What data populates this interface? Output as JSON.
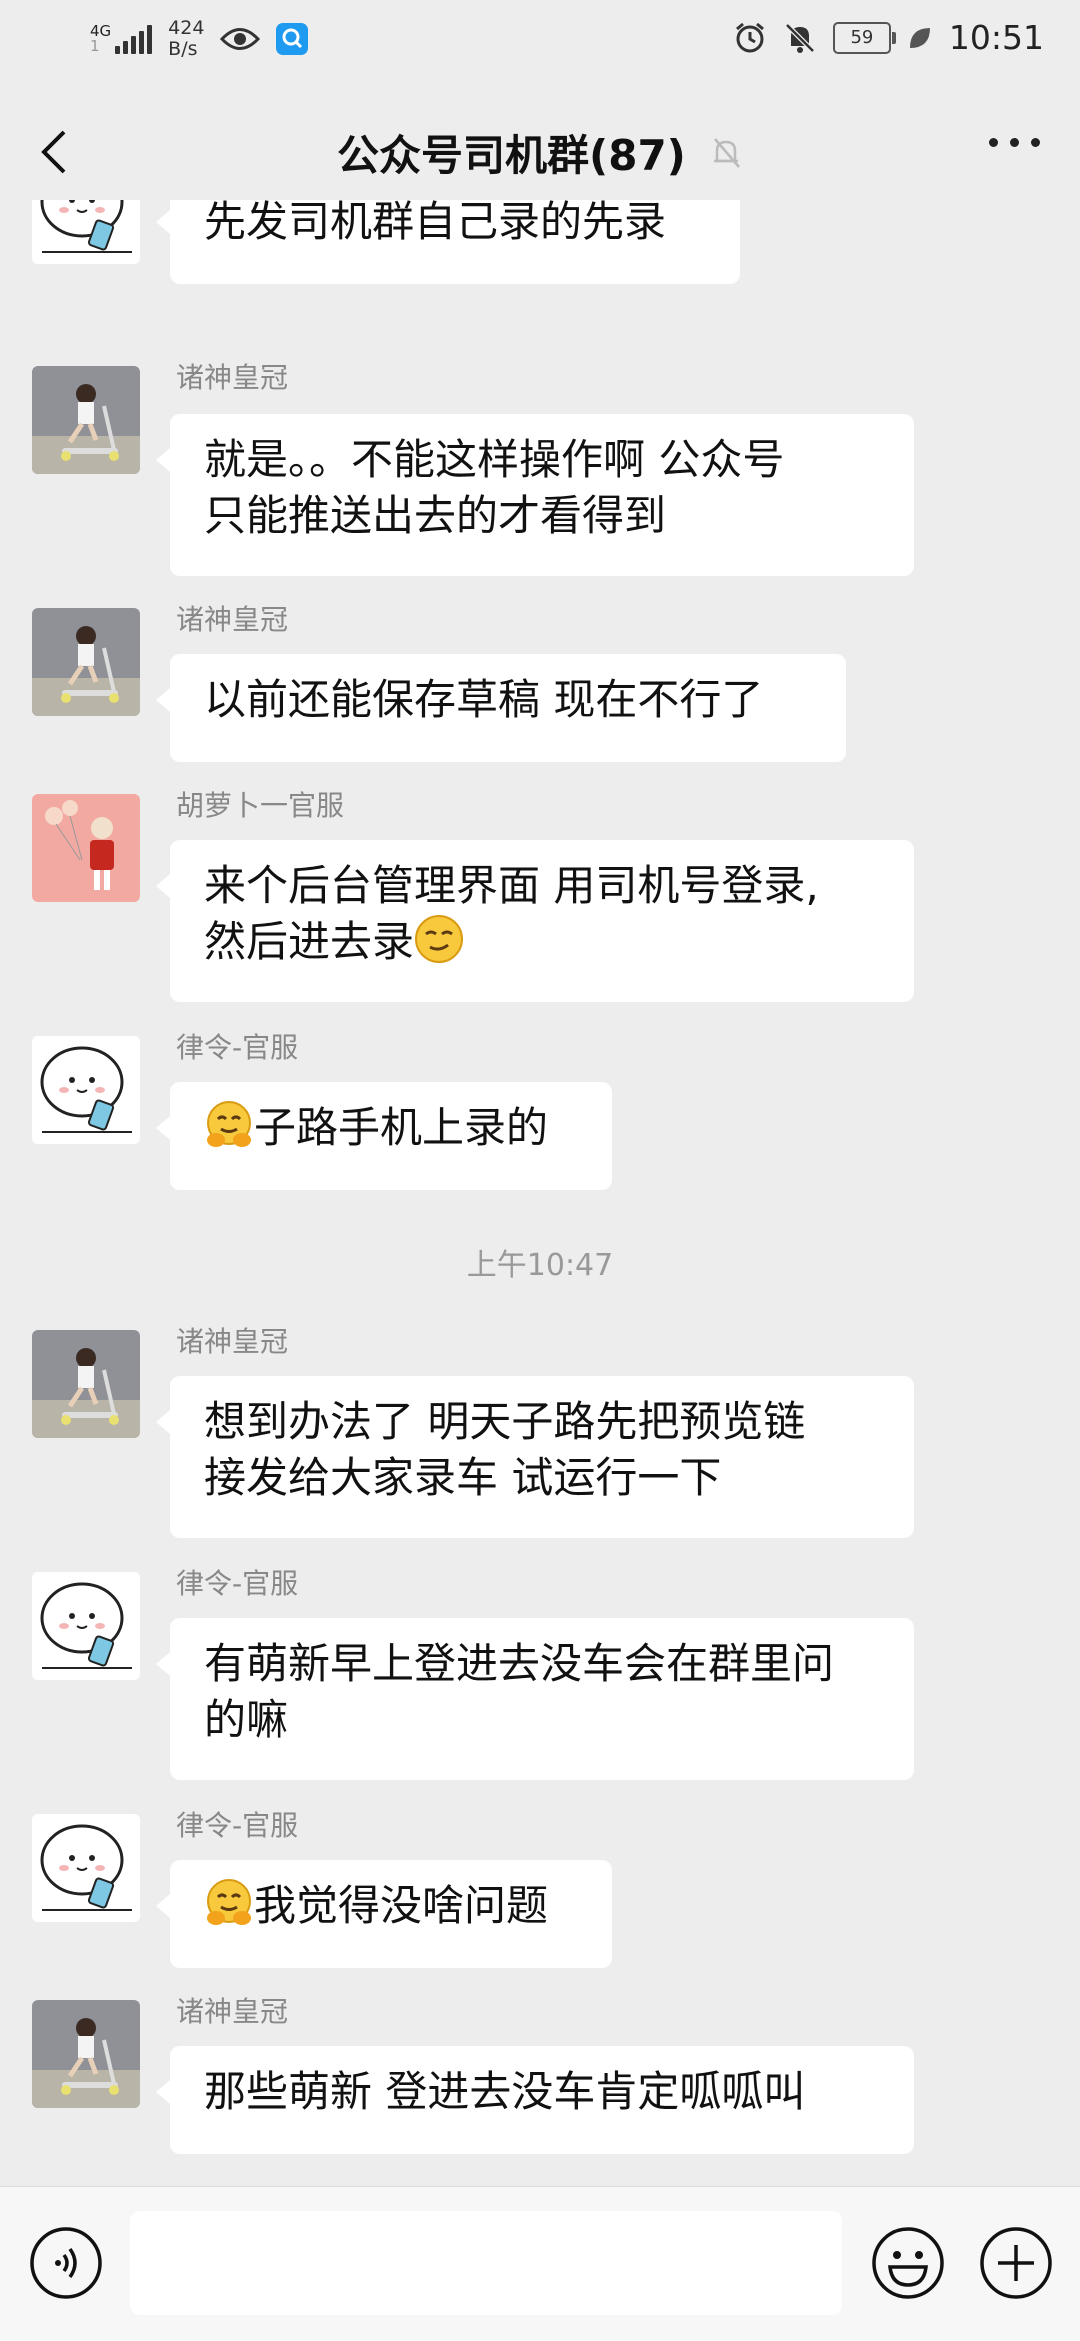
{
  "status_bar": {
    "network": "4G",
    "network_sub": "1",
    "speed_value": "424",
    "speed_unit": "B/s",
    "battery": "59",
    "time": "10:51"
  },
  "header": {
    "title": "公众号司机群(87)"
  },
  "chat": {
    "messages": [
      {
        "sender": "",
        "text": "先发司机群自己录的先录"
      },
      {
        "sender": "诸神皇冠",
        "line1": "就是。。不能这样操作啊 公众号",
        "line2": "只能推送出去的才看得到"
      },
      {
        "sender": "诸神皇冠",
        "text": "以前还能保存草稿 现在不行了"
      },
      {
        "sender": "胡萝卜一官服",
        "line1": "来个后台管理界面  用司机号登录,",
        "line2": "然后进去录"
      },
      {
        "sender": "律令-官服",
        "text": "子路手机上录的"
      },
      {
        "sender": "诸神皇冠",
        "line1": "想到办法了 明天子路先把预览链",
        "line2": "接发给大家录车 试运行一下"
      },
      {
        "sender": "律令-官服",
        "line1": "有萌新早上登进去没车会在群里问",
        "line2": "的嘛"
      },
      {
        "sender": "律令-官服",
        "text": "我觉得没啥问题"
      },
      {
        "sender": "诸神皇冠",
        "text": "那些萌新 登进去没车肯定呱呱叫"
      }
    ],
    "timestamp": "上午10:47"
  },
  "input_bar": {
    "value": ""
  },
  "colors": {
    "background": "#ededed",
    "bubble": "#ffffff",
    "sender_text": "#888888",
    "timestamp_text": "#999999"
  }
}
